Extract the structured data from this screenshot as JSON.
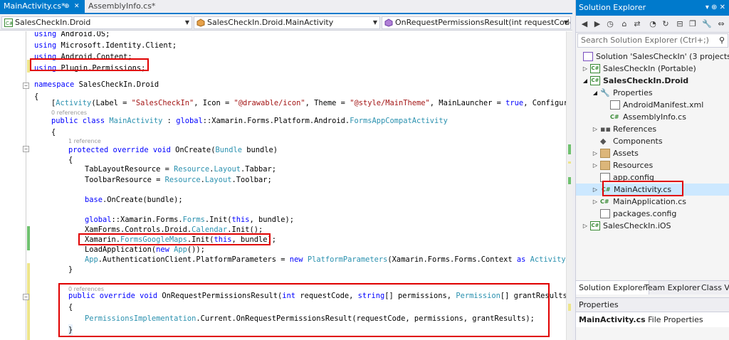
{
  "tabs": {
    "active_label": "MainActivity.cs*",
    "inactive_label": "AssemblyInfo.cs*",
    "pin_glyph": "⊕",
    "close_glyph": "✕"
  },
  "nav": {
    "project": "SalesCheckIn.Droid",
    "type": "SalesCheckIn.Droid.MainActivity",
    "member": "OnRequestPermissionsResult(int requestCode, s"
  },
  "code": {
    "l1_kw": "using",
    "l1_rest": " Android.OS;",
    "l2_kw": "using",
    "l2_rest": " Microsoft.Identity.Client;",
    "l3_kw": "using",
    "l3_rest": " Android.Content;",
    "l4_kw": "using",
    "l4_rest": " Plugin.Permissions;",
    "ns_kw": "namespace",
    "ns_rest": " SalesCheckIn.Droid",
    "brace_open": "{",
    "brace_close": "}",
    "attr_pre": "[",
    "attr_type": "Activity",
    "attr_lbl": "(Label = ",
    "attr_str1": "\"SalesCheckIn\"",
    "attr_icon": ", Icon = ",
    "attr_str2": "\"@drawable/icon\"",
    "attr_theme": ", Theme = ",
    "attr_str3": "\"@style/MainTheme\"",
    "attr_ml": ", MainLauncher = ",
    "attr_true": "true",
    "attr_cfg": ", Configuratio",
    "refs0": "0 references",
    "refs1": "1 reference",
    "cls_kw": "public class",
    "cls_sp": " ",
    "cls_name": "MainActivity",
    "cls_colon": " : ",
    "cls_global": "global",
    "cls_path": "::Xamarin.Forms.Platform.Android.",
    "cls_base": "FormsAppCompatActivity",
    "oc_kw": "protected override void",
    "oc_name": " OnCreate(",
    "oc_type": "Bundle",
    "oc_param": " bundle)",
    "tl_pre": "TabLayoutResource = ",
    "tl_res": "Resource",
    "tl_dot": ".",
    "tl_layout": "Layout",
    "tl_rest": ".Tabbar;",
    "tb_pre": "ToolbarResource = ",
    "tb_rest": ".Toolbar;",
    "base_kw": "base",
    "base_rest": ".OnCreate(bundle);",
    "gl_kw": "global",
    "gl_mid": "::Xamarin.Forms.",
    "gl_forms": "Forms",
    "gl_init": ".Init(",
    "gl_this": "this",
    "gl_end": ", bundle);",
    "xf_pre": "XamForms.Controls.Droid.",
    "xf_cal": "Calendar",
    "xf_end": ".Init();",
    "gm_pre": "Xamarin.",
    "gm_type": "FormsGoogleMaps",
    "gm_init": ".Init(",
    "gm_this": "this",
    "gm_end": ", bundle);",
    "la_pre": "LoadApplication(",
    "la_new": "new",
    "la_app": " App",
    "la_end": "());",
    "ac_app": "App",
    "ac_mid": ".AuthenticationClient.PlatformParameters = ",
    "ac_new": "new",
    "ac_pp": " PlatformParameters",
    "ac_args": "(Xamarin.Forms.Forms.Context ",
    "ac_as": "as",
    "ac_act": " Activity",
    "ac_end": ");",
    "rp_kw": "public override void",
    "rp_name": " OnRequestPermissionsResult(",
    "rp_int": "int",
    "rp_rc": " requestCode, ",
    "rp_string": "string",
    "rp_perm": "[] permissions, ",
    "rp_ptype": "Permission",
    "rp_gr": "[] grantResults)",
    "pi_type": "PermissionsImplementation",
    "pi_rest": ".Current.OnRequestPermissionsResult(requestCode, permissions, grantResults);"
  },
  "solution_explorer": {
    "title": "Solution Explorer",
    "search_placeholder": "Search Solution Explorer (Ctrl+;)",
    "search_icon": "search-icon",
    "tree": [
      {
        "label": "Solution 'SalesCheckIn' (3 projects)"
      },
      {
        "label": "SalesCheckIn (Portable)"
      },
      {
        "label": "SalesCheckIn.Droid"
      },
      {
        "label": "Properties"
      },
      {
        "label": "AndroidManifest.xml"
      },
      {
        "label": "AssemblyInfo.cs"
      },
      {
        "label": "References"
      },
      {
        "label": "Components"
      },
      {
        "label": "Assets"
      },
      {
        "label": "Resources"
      },
      {
        "label": "app.config"
      },
      {
        "label": "MainActivity.cs"
      },
      {
        "label": "MainApplication.cs"
      },
      {
        "label": "packages.config"
      },
      {
        "label": "SalesCheckIn.iOS"
      }
    ],
    "csfile_glyph": "C#",
    "bottom_tabs": [
      "Solution Explorer",
      "Team Explorer",
      "Class Vie"
    ]
  },
  "properties": {
    "title": "Properties",
    "object_name": "MainActivity.cs",
    "object_type": "File Properties"
  },
  "colors": {
    "accent": "#007acc",
    "highlight_box": "#e00000",
    "keyword": "#0000ff",
    "type": "#2b91af",
    "string": "#a31515"
  }
}
